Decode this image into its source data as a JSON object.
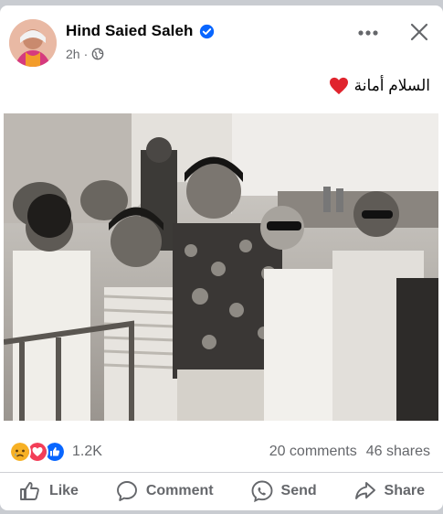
{
  "post": {
    "author": "Hind Saied Saleh",
    "time": "2h",
    "separator": "·",
    "caption": "السلام أمانة",
    "photo_description_icon": "black-and-white-group-photo"
  },
  "engagement": {
    "reaction_count": "1.2K",
    "comments": "20 comments",
    "shares": "46 shares"
  },
  "actions": {
    "like": "Like",
    "comment": "Comment",
    "send": "Send",
    "share": "Share"
  },
  "colors": {
    "brand_blue": "#0866ff",
    "heart_red": "#e0242d",
    "reaction_yellow": "#f7b125",
    "muted_text": "#65676b"
  }
}
